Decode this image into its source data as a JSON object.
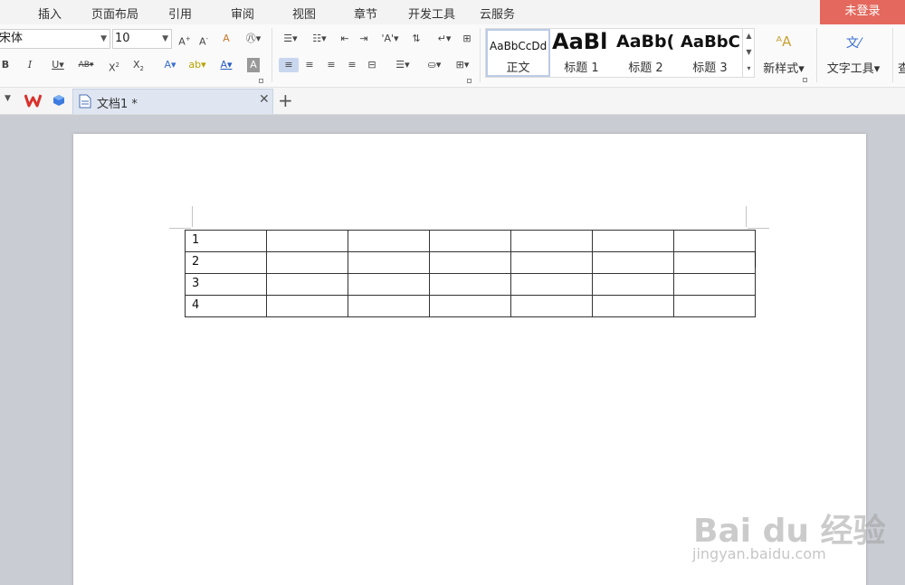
{
  "menubar": {
    "items": [
      "插入",
      "页面布局",
      "引用",
      "审阅",
      "视图",
      "章节",
      "开发工具",
      "云服务"
    ],
    "login_label": "未登录"
  },
  "ribbon": {
    "font_name": "宋体",
    "font_size": "10",
    "styles": [
      {
        "sample": "AaBbCcDd",
        "name": "正文"
      },
      {
        "sample": "AaBl",
        "name": "标题 1"
      },
      {
        "sample": "AaBb(",
        "name": "标题 2"
      },
      {
        "sample": "AaBbC",
        "name": "标题 3"
      }
    ],
    "new_style_label": "新样式",
    "text_tools_label": "文字工具",
    "cut_off_label": "查"
  },
  "tabs": {
    "doc_name": "文档1 *"
  },
  "table": {
    "rows": [
      [
        "1",
        "",
        "",
        "",
        "",
        "",
        ""
      ],
      [
        "2",
        "",
        "",
        "",
        "",
        "",
        ""
      ],
      [
        "3",
        "",
        "",
        "",
        "",
        "",
        ""
      ],
      [
        "4",
        "",
        "",
        "",
        "",
        "",
        ""
      ]
    ]
  },
  "watermark": {
    "main": "Bai du 经验",
    "sub": "jingyan.baidu.com"
  },
  "colors": {
    "login_bg": "#e4685d",
    "accent_blue": "#2b5cc4",
    "wps_red": "#d9302b"
  }
}
